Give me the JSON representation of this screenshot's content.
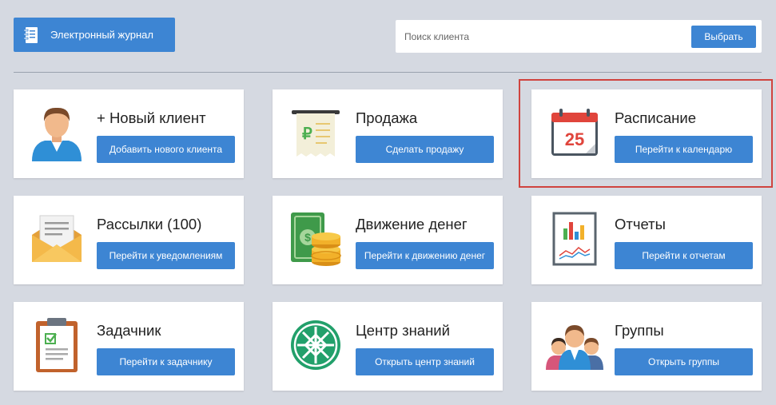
{
  "header": {
    "journal_label": "Электронный журнал",
    "search_placeholder": "Поиск клиента",
    "search_value": "",
    "select_label": "Выбрать"
  },
  "cards": [
    {
      "title": "+ Новый клиент",
      "button": "Добавить нового клиента",
      "icon": "user-icon"
    },
    {
      "title": "Продажа",
      "button": "Сделать продажу",
      "icon": "receipt-icon"
    },
    {
      "title": "Расписание",
      "button": "Перейти к календарю",
      "icon": "calendar-icon",
      "calendar_day": "25"
    },
    {
      "title": "Рассылки (100)",
      "button": "Перейти к уведомлениям",
      "icon": "envelope-icon"
    },
    {
      "title": "Движение денег",
      "button": "Перейти к движению денег",
      "icon": "money-icon"
    },
    {
      "title": "Отчеты",
      "button": "Перейти к отчетам",
      "icon": "report-icon"
    },
    {
      "title": "Задачник",
      "button": "Перейти к задачнику",
      "icon": "clipboard-icon"
    },
    {
      "title": "Центр знаний",
      "button": "Открыть центр знаний",
      "icon": "knowledge-icon"
    },
    {
      "title": "Группы",
      "button": "Открыть группы",
      "icon": "group-icon"
    }
  ],
  "colors": {
    "primary": "#3d85d3",
    "background": "#d5d9e1",
    "highlight": "#d0443f"
  }
}
